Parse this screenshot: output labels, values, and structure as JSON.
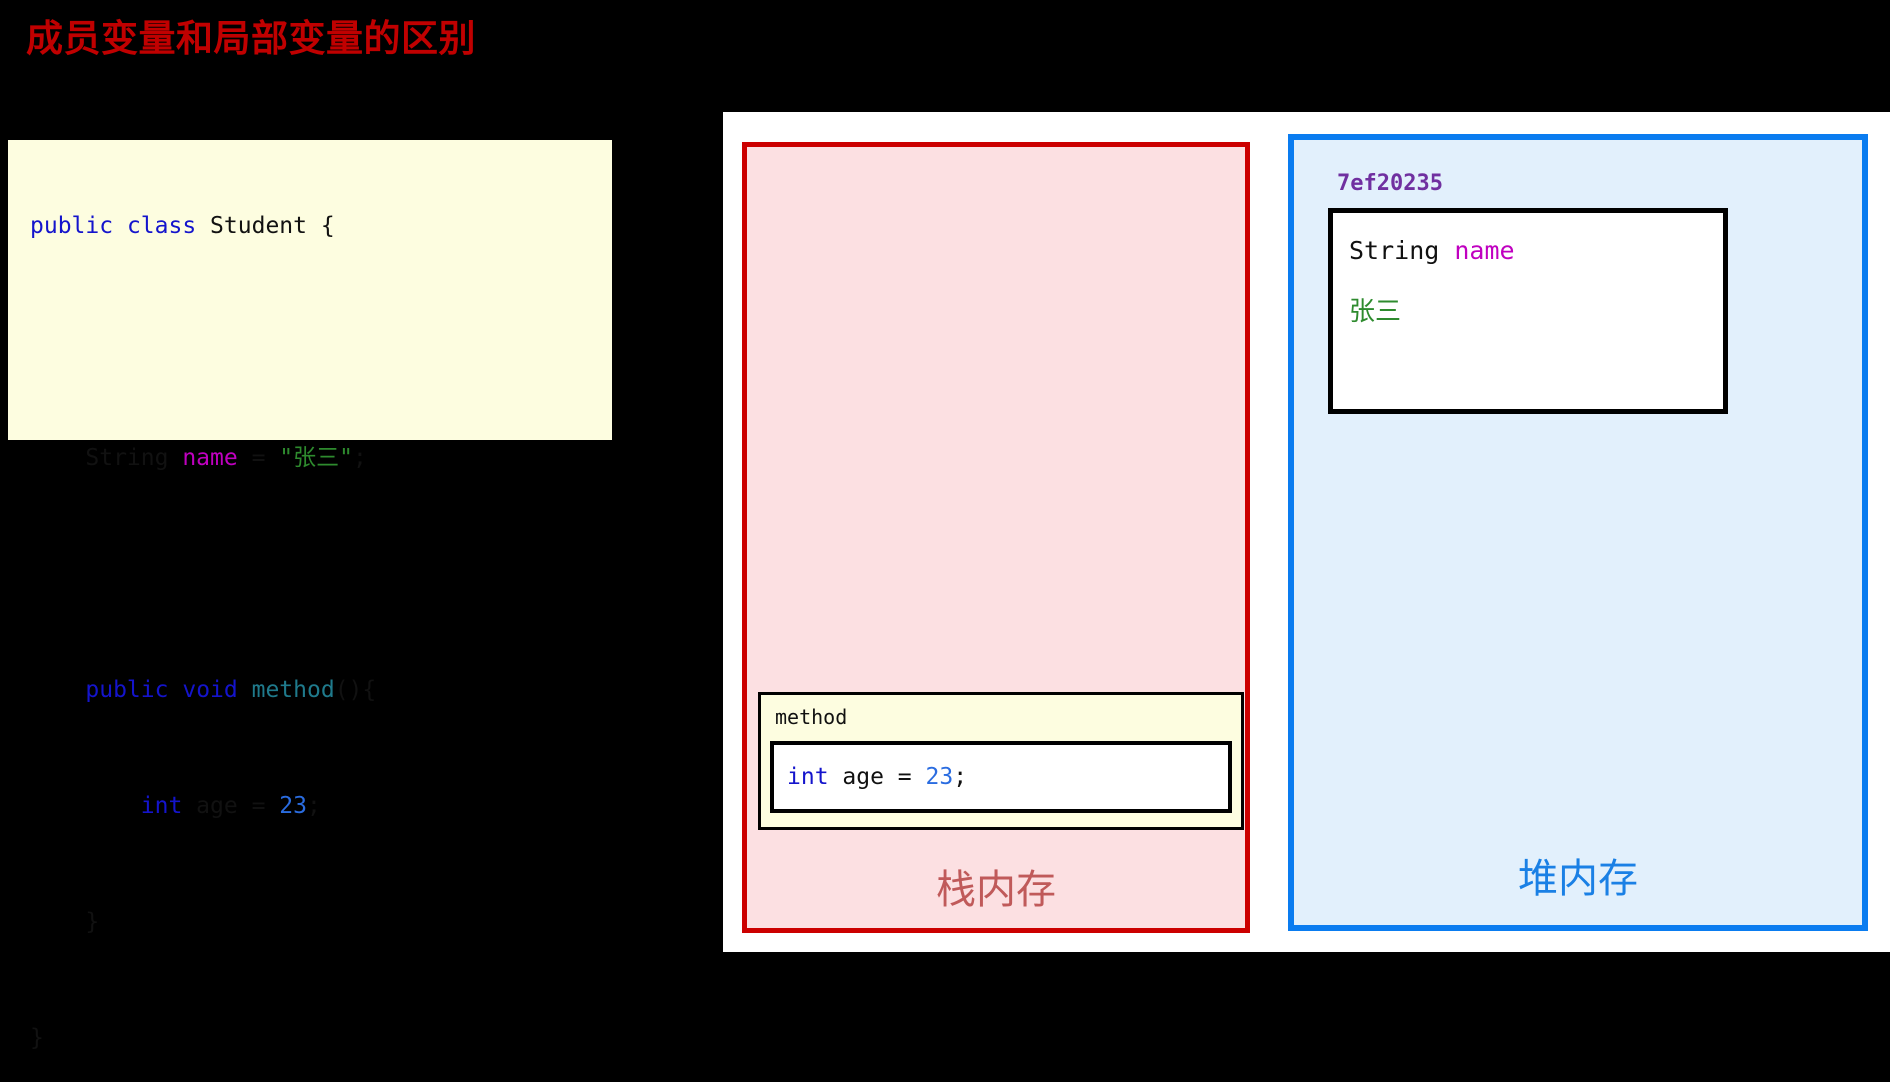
{
  "slide": {
    "title": "成员变量和局部变量的区别",
    "title_color": "#C00000",
    "background_color": "#000000"
  },
  "code_panel": {
    "background_color": "#FDFDE0",
    "language": "java",
    "full_text": "public class Student {\n\n    String name = \"张三\";\n\n    public void method(){\n        int age = 23;\n    }\n}",
    "lines": [
      {
        "indent": "",
        "tokens": [
          {
            "text": "public",
            "kind": "keyword"
          },
          {
            "text": " ",
            "kind": "plain"
          },
          {
            "text": "class",
            "kind": "keyword"
          },
          {
            "text": " Student {",
            "kind": "plain"
          }
        ]
      },
      {
        "indent": "",
        "tokens": []
      },
      {
        "indent": "    ",
        "tokens": [
          {
            "text": "String ",
            "kind": "type"
          },
          {
            "text": "name",
            "kind": "field"
          },
          {
            "text": " = ",
            "kind": "plain"
          },
          {
            "text": "\"张三\"",
            "kind": "string"
          },
          {
            "text": ";",
            "kind": "plain"
          }
        ]
      },
      {
        "indent": "",
        "tokens": []
      },
      {
        "indent": "    ",
        "tokens": [
          {
            "text": "public",
            "kind": "keyword"
          },
          {
            "text": " ",
            "kind": "plain"
          },
          {
            "text": "void",
            "kind": "keyword"
          },
          {
            "text": " ",
            "kind": "plain"
          },
          {
            "text": "method",
            "kind": "function"
          },
          {
            "text": "(){",
            "kind": "plain"
          }
        ]
      },
      {
        "indent": "        ",
        "tokens": [
          {
            "text": "int",
            "kind": "keyword"
          },
          {
            "text": " age = ",
            "kind": "plain"
          },
          {
            "text": "23",
            "kind": "number"
          },
          {
            "text": ";",
            "kind": "plain"
          }
        ]
      },
      {
        "indent": "    ",
        "tokens": [
          {
            "text": "}",
            "kind": "plain"
          }
        ]
      },
      {
        "indent": "",
        "tokens": [
          {
            "text": "}",
            "kind": "plain"
          }
        ]
      }
    ],
    "token_colors": {
      "keyword": "#1414CC",
      "type": "#111111",
      "field": "#C000C0",
      "function": "#1F7A8C",
      "string": "#2E8B2E",
      "number": "#2A6CE0",
      "plain": "#111111"
    }
  },
  "stack": {
    "label": "栈内存",
    "label_color": "#C05A5A",
    "border_color": "#CC0000",
    "fill_color": "#FCE0E2",
    "frame": {
      "name": "method",
      "fill_color": "#FDFDE0",
      "local_variable": {
        "full_text": "int age = 23;",
        "keyword": "int",
        "identifier": " age = ",
        "value": "23",
        "terminator": ";"
      }
    }
  },
  "heap": {
    "label": "堆内存",
    "label_color": "#1A80E5",
    "border_color": "#0A7CF0",
    "fill_color": "#E2F0FC",
    "address": "7ef20235",
    "address_color": "#7030A0",
    "object": {
      "field_type": "String",
      "field_name": "name",
      "field_name_color": "#C000C0",
      "field_value": "张三",
      "field_value_color": "#2E8B2E"
    }
  }
}
